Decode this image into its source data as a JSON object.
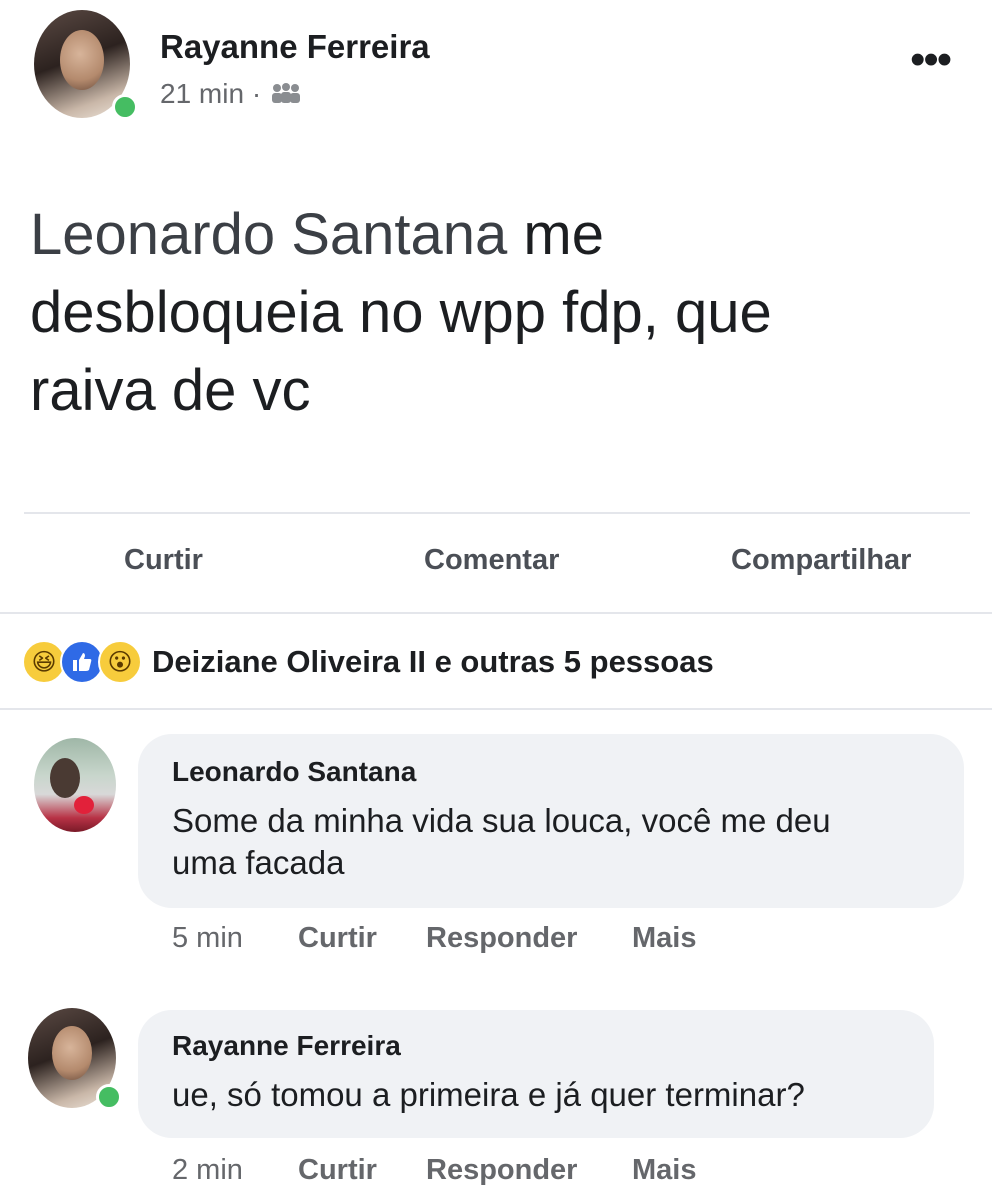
{
  "post": {
    "author": "Rayanne Ferreira",
    "time": "21 min",
    "separator": "·",
    "audience_icon": "friends-icon",
    "more_icon": "•••",
    "mention": "Leonardo Santana",
    "text_line1_rest": " me",
    "text_line2": "desbloqueia no wpp fdp, que",
    "text_line3": "raiva de vc"
  },
  "actions": {
    "like": "Curtir",
    "comment": "Comentar",
    "share": "Compartilhar"
  },
  "reactions": {
    "icons": [
      "haha-icon",
      "like-icon",
      "wow-icon"
    ],
    "summary": "Deiziane Oliveira II e outras 5 pessoas"
  },
  "comments": [
    {
      "author": "Leonardo Santana",
      "line1": "Some da minha vida sua louca, você me deu",
      "line2": "uma facada",
      "time": "5 min",
      "like": "Curtir",
      "reply": "Responder",
      "more": "Mais"
    },
    {
      "author": "Rayanne Ferreira",
      "line1": "ue, só tomou a primeira e já quer terminar?",
      "time": "2 min",
      "like": "Curtir",
      "reply": "Responder",
      "more": "Mais"
    }
  ],
  "colors": {
    "online": "#45bd62",
    "bubble": "#f0f2f5",
    "like_blue": "#2f6ae6",
    "emoji_yellow": "#f7cc3c"
  }
}
